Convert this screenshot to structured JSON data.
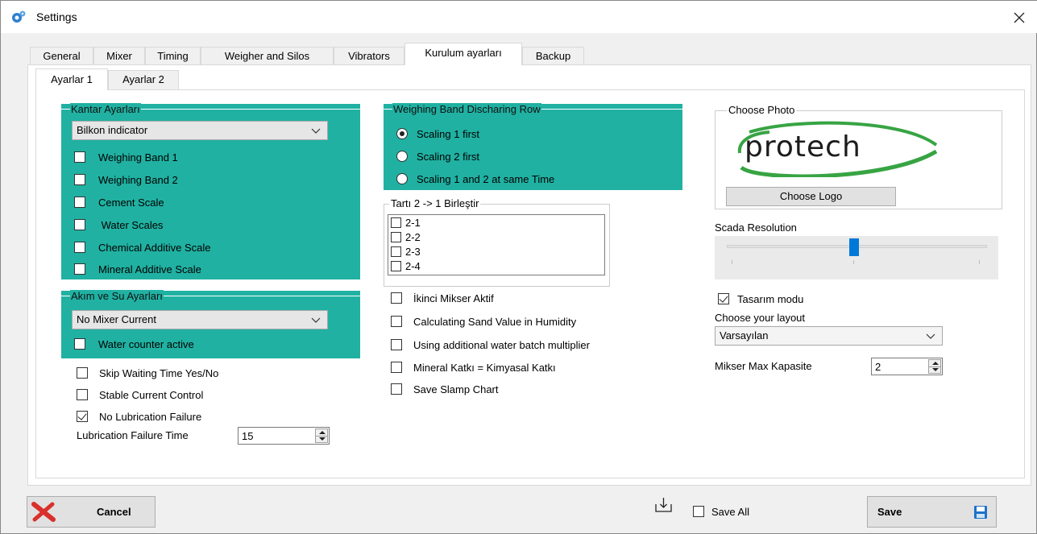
{
  "window": {
    "title": "Settings"
  },
  "tabs": [
    "General",
    "Mixer",
    "Timing",
    "Weigher and Silos",
    "Vibrators",
    "Kurulum ayarları",
    "Backup"
  ],
  "subtabs": [
    "Ayarlar 1",
    "Ayarlar 2"
  ],
  "kantar": {
    "title": "Kantar Ayarları",
    "combo_value": "Bilkon indicator",
    "items": [
      "Weighing Band 1",
      "Weighing Band 2",
      "Cement Scale",
      " Water Scales",
      "Chemical Additive Scale",
      "Mineral Additive Scale"
    ]
  },
  "akim": {
    "title": "Akım ve Su Ayarları",
    "combo_value": "No Mixer Current",
    "water_counter": "Water counter active"
  },
  "misc": {
    "skip_waiting": "Skip Waiting Time Yes/No",
    "stable_current": "Stable Current Control",
    "no_lubrication": "No Lubrication Failure",
    "lubrication_time_label": "Lubrication Failure Time",
    "lubrication_time_value": "15"
  },
  "weighing_band": {
    "title": "Weighing Band Discharing Row",
    "options": [
      "Scaling 1 first",
      "Scaling 2 first",
      "Scaling 1 and 2 at same Time"
    ]
  },
  "tarti": {
    "title": "Tartı 2 -> 1 Birleştir",
    "items": [
      "2-1",
      "2-2",
      "2-3",
      "2-4"
    ]
  },
  "middle_checks": [
    "İkinci Mikser Aktif",
    "Calculating Sand Value in Humidity",
    "Using additional water batch multiplier",
    "Mineral Katkı = Kimyasal Katkı",
    "Save Slamp Chart"
  ],
  "photo": {
    "title": "Choose Photo",
    "logo_text": "protech",
    "choose_logo": "Choose Logo"
  },
  "scada": {
    "title": "Scada Resolution",
    "slider_position": 0.49
  },
  "right": {
    "tasarim": "Tasarım modu",
    "layout_label": "Choose your layout",
    "layout_value": "Varsayılan",
    "mikser_label": "Mikser Max Kapasite",
    "mikser_value": "2"
  },
  "bottom": {
    "cancel": "Cancel",
    "save_all": "Save All",
    "save": "Save"
  },
  "colors": {
    "teal": "#20b1a2",
    "accent": "#0078d7",
    "cancel_x": "#d9302c"
  }
}
